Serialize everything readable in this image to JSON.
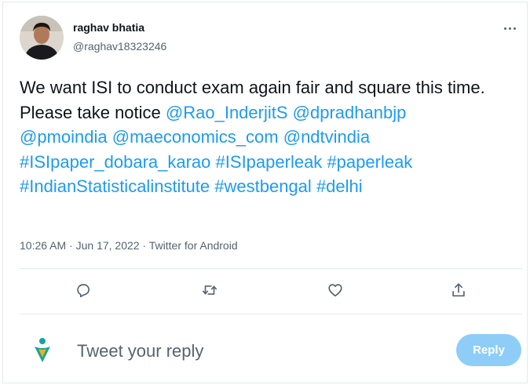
{
  "author": {
    "display_name": "raghav bhatia",
    "handle": "@raghav18323246"
  },
  "tweet": {
    "segments": [
      {
        "text": "We want ISI to conduct exam again fair and square this time.",
        "link": false
      },
      {
        "text": " Please take notice ",
        "link": false
      },
      {
        "text": "@Rao_InderjitS",
        "link": true
      },
      {
        "text": " ",
        "link": false
      },
      {
        "text": "@dpradhanbjp",
        "link": true
      },
      {
        "text": "@pmoindia",
        "link": true
      },
      {
        "text": " ",
        "link": false
      },
      {
        "text": "@maeconomics_com",
        "link": true
      },
      {
        "text": " ",
        "link": false
      },
      {
        "text": "@ndtvindia",
        "link": true
      },
      {
        "text": "#ISIpaper_dobara_karao",
        "link": true
      },
      {
        "text": " ",
        "link": false
      },
      {
        "text": "#ISIpaperleak",
        "link": true
      },
      {
        "text": " ",
        "link": false
      },
      {
        "text": "#paperleak",
        "link": true
      },
      {
        "text": "#IndianStatisticalinstitute",
        "link": true
      },
      {
        "text": " ",
        "link": false
      },
      {
        "text": "#westbengal",
        "link": true
      },
      {
        "text": " ",
        "link": false
      },
      {
        "text": "#delhi",
        "link": true
      }
    ]
  },
  "meta": {
    "time": "10:26 AM",
    "separator": " · ",
    "date": "Jun 17, 2022",
    "source": "Twitter for Android"
  },
  "actions": {
    "reply_icon": "reply-icon",
    "retweet_icon": "retweet-icon",
    "like_icon": "like-icon",
    "share_icon": "share-icon"
  },
  "composer": {
    "placeholder": "Tweet your reply",
    "button_label": "Reply"
  },
  "colors": {
    "link": "#1d9bf0",
    "secondary_text": "#536471",
    "reply_button": "#8ecdf8",
    "divider": "#e6e9ec"
  }
}
